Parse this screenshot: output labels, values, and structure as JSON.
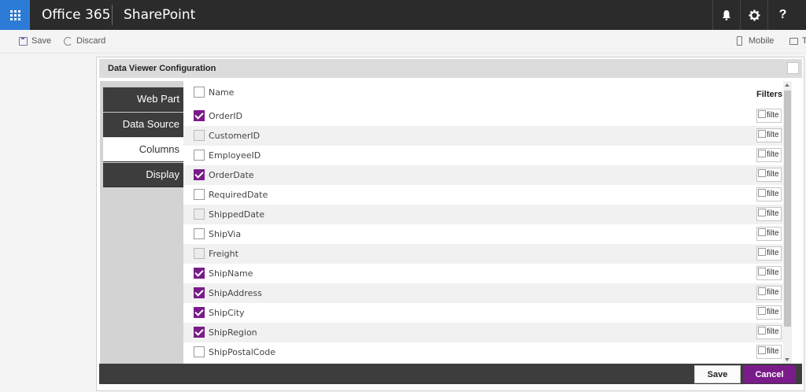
{
  "suitebar": {
    "brand": "Office 365",
    "app_name": "SharePoint",
    "notifications_icon": "bell-icon",
    "settings_icon": "gear-icon",
    "help_label": "?"
  },
  "commandbar": {
    "save_label": "Save",
    "discard_label": "Discard",
    "mobile_label": "Mobile",
    "tablet_label": "T"
  },
  "panel": {
    "title": "Data Viewer Configuration",
    "tabs": [
      {
        "label": "Web Part",
        "active": false
      },
      {
        "label": "Data Source",
        "active": false
      },
      {
        "label": "Columns",
        "active": true
      },
      {
        "label": "Display",
        "active": false
      }
    ],
    "name_header": "Name",
    "filters_header": "Filters",
    "filter_alt": "filte",
    "columns": [
      {
        "name": "OrderID",
        "checked": true
      },
      {
        "name": "CustomerID",
        "checked": false
      },
      {
        "name": "EmployeeID",
        "checked": false
      },
      {
        "name": "OrderDate",
        "checked": true
      },
      {
        "name": "RequiredDate",
        "checked": false
      },
      {
        "name": "ShippedDate",
        "checked": false
      },
      {
        "name": "ShipVia",
        "checked": false
      },
      {
        "name": "Freight",
        "checked": false
      },
      {
        "name": "ShipName",
        "checked": true
      },
      {
        "name": "ShipAddress",
        "checked": true
      },
      {
        "name": "ShipCity",
        "checked": true
      },
      {
        "name": "ShipRegion",
        "checked": true
      },
      {
        "name": "ShipPostalCode",
        "checked": false
      }
    ],
    "save_label": "Save",
    "cancel_label": "Cancel"
  },
  "colors": {
    "suitebar": "#2b2b2b",
    "waffle": "#2c7bd6",
    "accent": "#7a1b8a",
    "nav_tab": "#3d3d3d"
  }
}
